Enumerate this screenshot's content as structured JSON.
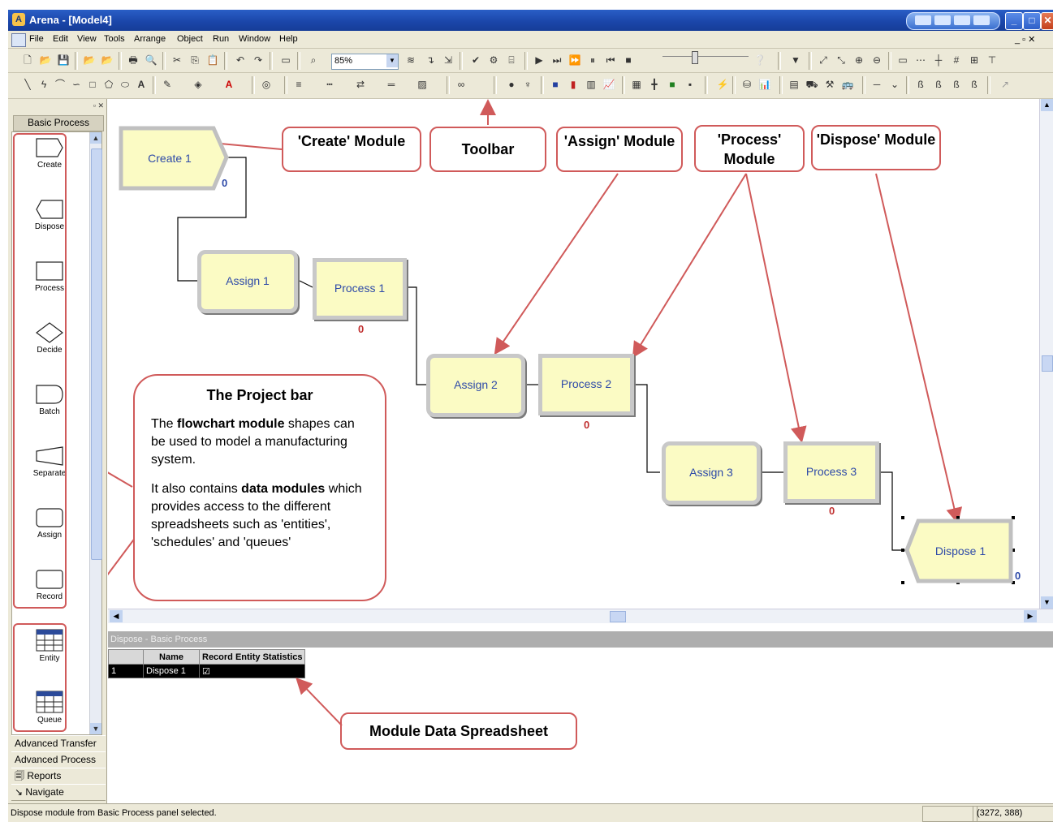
{
  "window": {
    "title": "Arena - [Model4]"
  },
  "menu": [
    "File",
    "Edit",
    "View",
    "Tools",
    "Arrange",
    "Object",
    "Run",
    "Window",
    "Help"
  ],
  "toolbar": {
    "zoom": "85%"
  },
  "project_bar": {
    "panel_title": "Basic Process",
    "shapes": [
      {
        "label": "Create",
        "icon": "create-shape-icon"
      },
      {
        "label": "Dispose",
        "icon": "dispose-shape-icon"
      },
      {
        "label": "Process",
        "icon": "process-shape-icon"
      },
      {
        "label": "Decide",
        "icon": "decide-diamond-icon"
      },
      {
        "label": "Batch",
        "icon": "batch-shape-icon"
      },
      {
        "label": "Separate",
        "icon": "separate-shape-icon"
      },
      {
        "label": "Assign",
        "icon": "assign-shape-icon"
      },
      {
        "label": "Record",
        "icon": "record-shape-icon"
      }
    ],
    "data_modules": [
      {
        "label": "Entity",
        "icon": "spreadsheet-icon"
      },
      {
        "label": "Queue",
        "icon": "spreadsheet-icon"
      }
    ],
    "panels": [
      "Advanced Transfer",
      "Advanced Process",
      "Reports",
      "Navigate"
    ]
  },
  "flowchart": {
    "modules": [
      {
        "id": "create1",
        "label": "Create 1",
        "counter": "0"
      },
      {
        "id": "assign1",
        "label": "Assign 1"
      },
      {
        "id": "process1",
        "label": "Process 1",
        "counter": "0"
      },
      {
        "id": "assign2",
        "label": "Assign 2"
      },
      {
        "id": "process2",
        "label": "Process 2",
        "counter": "0"
      },
      {
        "id": "assign3",
        "label": "Assign 3"
      },
      {
        "id": "process3",
        "label": "Process 3",
        "counter": "0"
      },
      {
        "id": "dispose1",
        "label": "Dispose 1",
        "counter": "0"
      }
    ]
  },
  "callouts": {
    "create": "'Create' Module",
    "toolbar": "Toolbar",
    "assign": "'Assign' Module",
    "process": "'Process' Module",
    "dispose": "'Dispose' Module",
    "spreadsheet": "Module Data  Spreadsheet"
  },
  "project_note": {
    "title": "The Project bar",
    "p1_pre": "The ",
    "p1_bold": "flowchart module",
    "p1_post": " shapes can be used to model a manufacturing system.",
    "p2_pre": "It also contains ",
    "p2_bold": "data modules",
    "p2_post": " which provides access to the different spreadsheets such as 'entities', 'schedules' and 'queues'"
  },
  "spreadsheet": {
    "title": "Dispose - Basic Process",
    "columns": [
      "",
      "Name",
      "Record Entity Statistics"
    ],
    "rows": [
      {
        "num": "1",
        "name": "Dispose 1",
        "record_stats": "☑"
      }
    ]
  },
  "status": {
    "message": "Dispose module from Basic Process panel selected.",
    "coords": "(3272, 388)"
  },
  "colors": {
    "module_fill": "#fbfbc4",
    "module_text": "#2e4aa8",
    "annotation_red": "#d05a5a",
    "title_blue": "#1a45a8"
  }
}
